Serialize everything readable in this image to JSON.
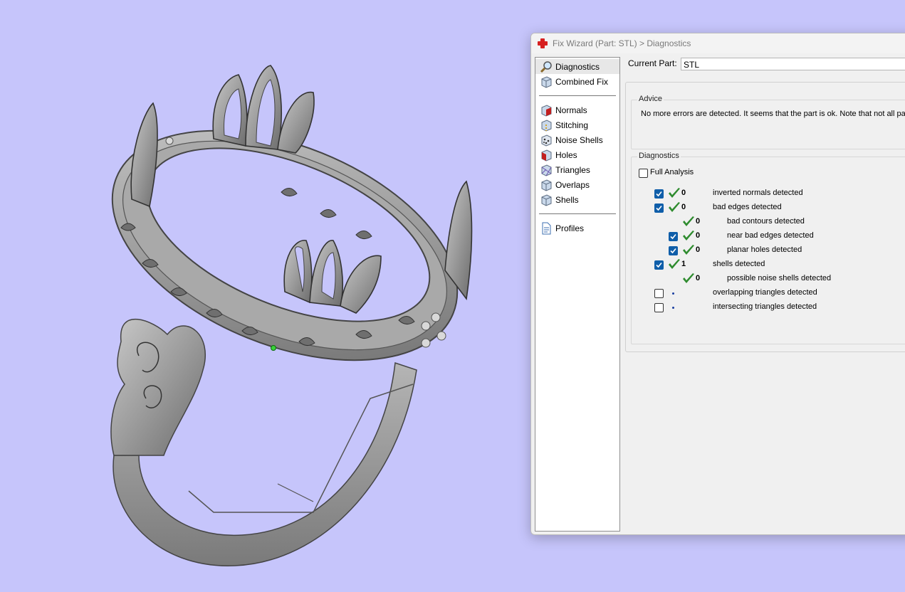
{
  "window": {
    "title": "Fix Wizard (Part: STL) > Diagnostics",
    "icon": "red-cross-icon"
  },
  "nav": {
    "items": [
      {
        "label": "Diagnostics",
        "icon": "magnifier-icon",
        "active": true
      },
      {
        "label": "Combined Fix",
        "icon": "cube-icon"
      },
      {
        "label": "Normals",
        "icon": "normals-cube-icon"
      },
      {
        "label": "Stitching",
        "icon": "stitching-cube-icon"
      },
      {
        "label": "Noise Shells",
        "icon": "noise-shells-icon"
      },
      {
        "label": "Holes",
        "icon": "holes-cube-icon"
      },
      {
        "label": "Triangles",
        "icon": "triangles-cube-icon"
      },
      {
        "label": "Overlaps",
        "icon": "overlaps-cube-icon"
      },
      {
        "label": "Shells",
        "icon": "shells-cube-icon"
      },
      {
        "label": "Profiles",
        "icon": "document-icon"
      }
    ]
  },
  "current_part": {
    "label": "Current Part:",
    "value": "STL"
  },
  "advice": {
    "title": "Advice",
    "text": "No more errors are detected. It seems that the part is ok. Note that not all pa"
  },
  "diagnostics": {
    "title": "Diagnostics",
    "full_analysis": {
      "label": "Full Analysis",
      "checked": false
    },
    "rows": [
      {
        "checkbox": true,
        "checked": true,
        "status": "ok",
        "count": "0",
        "label": "inverted normals detected",
        "indent": 0
      },
      {
        "checkbox": true,
        "checked": true,
        "status": "ok",
        "count": "0",
        "label": "bad edges detected",
        "indent": 0
      },
      {
        "checkbox": false,
        "checked": false,
        "status": "ok",
        "count": "0",
        "label": "bad contours detected",
        "indent": 1
      },
      {
        "checkbox": true,
        "checked": true,
        "status": "ok",
        "count": "0",
        "label": "near bad edges detected",
        "indent": 1
      },
      {
        "checkbox": true,
        "checked": true,
        "status": "ok",
        "count": "0",
        "label": "planar holes detected",
        "indent": 1
      },
      {
        "checkbox": true,
        "checked": true,
        "status": "ok",
        "count": "1",
        "label": "shells detected",
        "indent": 0
      },
      {
        "checkbox": false,
        "checked": false,
        "status": "ok",
        "count": "0",
        "label": "possible noise shells detected",
        "indent": 1
      },
      {
        "checkbox": true,
        "checked": false,
        "status": "pending",
        "count": "",
        "label": "overlapping triangles detected",
        "indent": 0
      },
      {
        "checkbox": true,
        "checked": false,
        "status": "pending",
        "count": "",
        "label": "intersecting triangles detected",
        "indent": 0
      }
    ]
  },
  "colors": {
    "viewport_bg": "#c6c5fb",
    "model_gray": "#9a9a9a",
    "check_green": "#2e8b2e",
    "checkbox_blue": "#0f5ea9"
  }
}
